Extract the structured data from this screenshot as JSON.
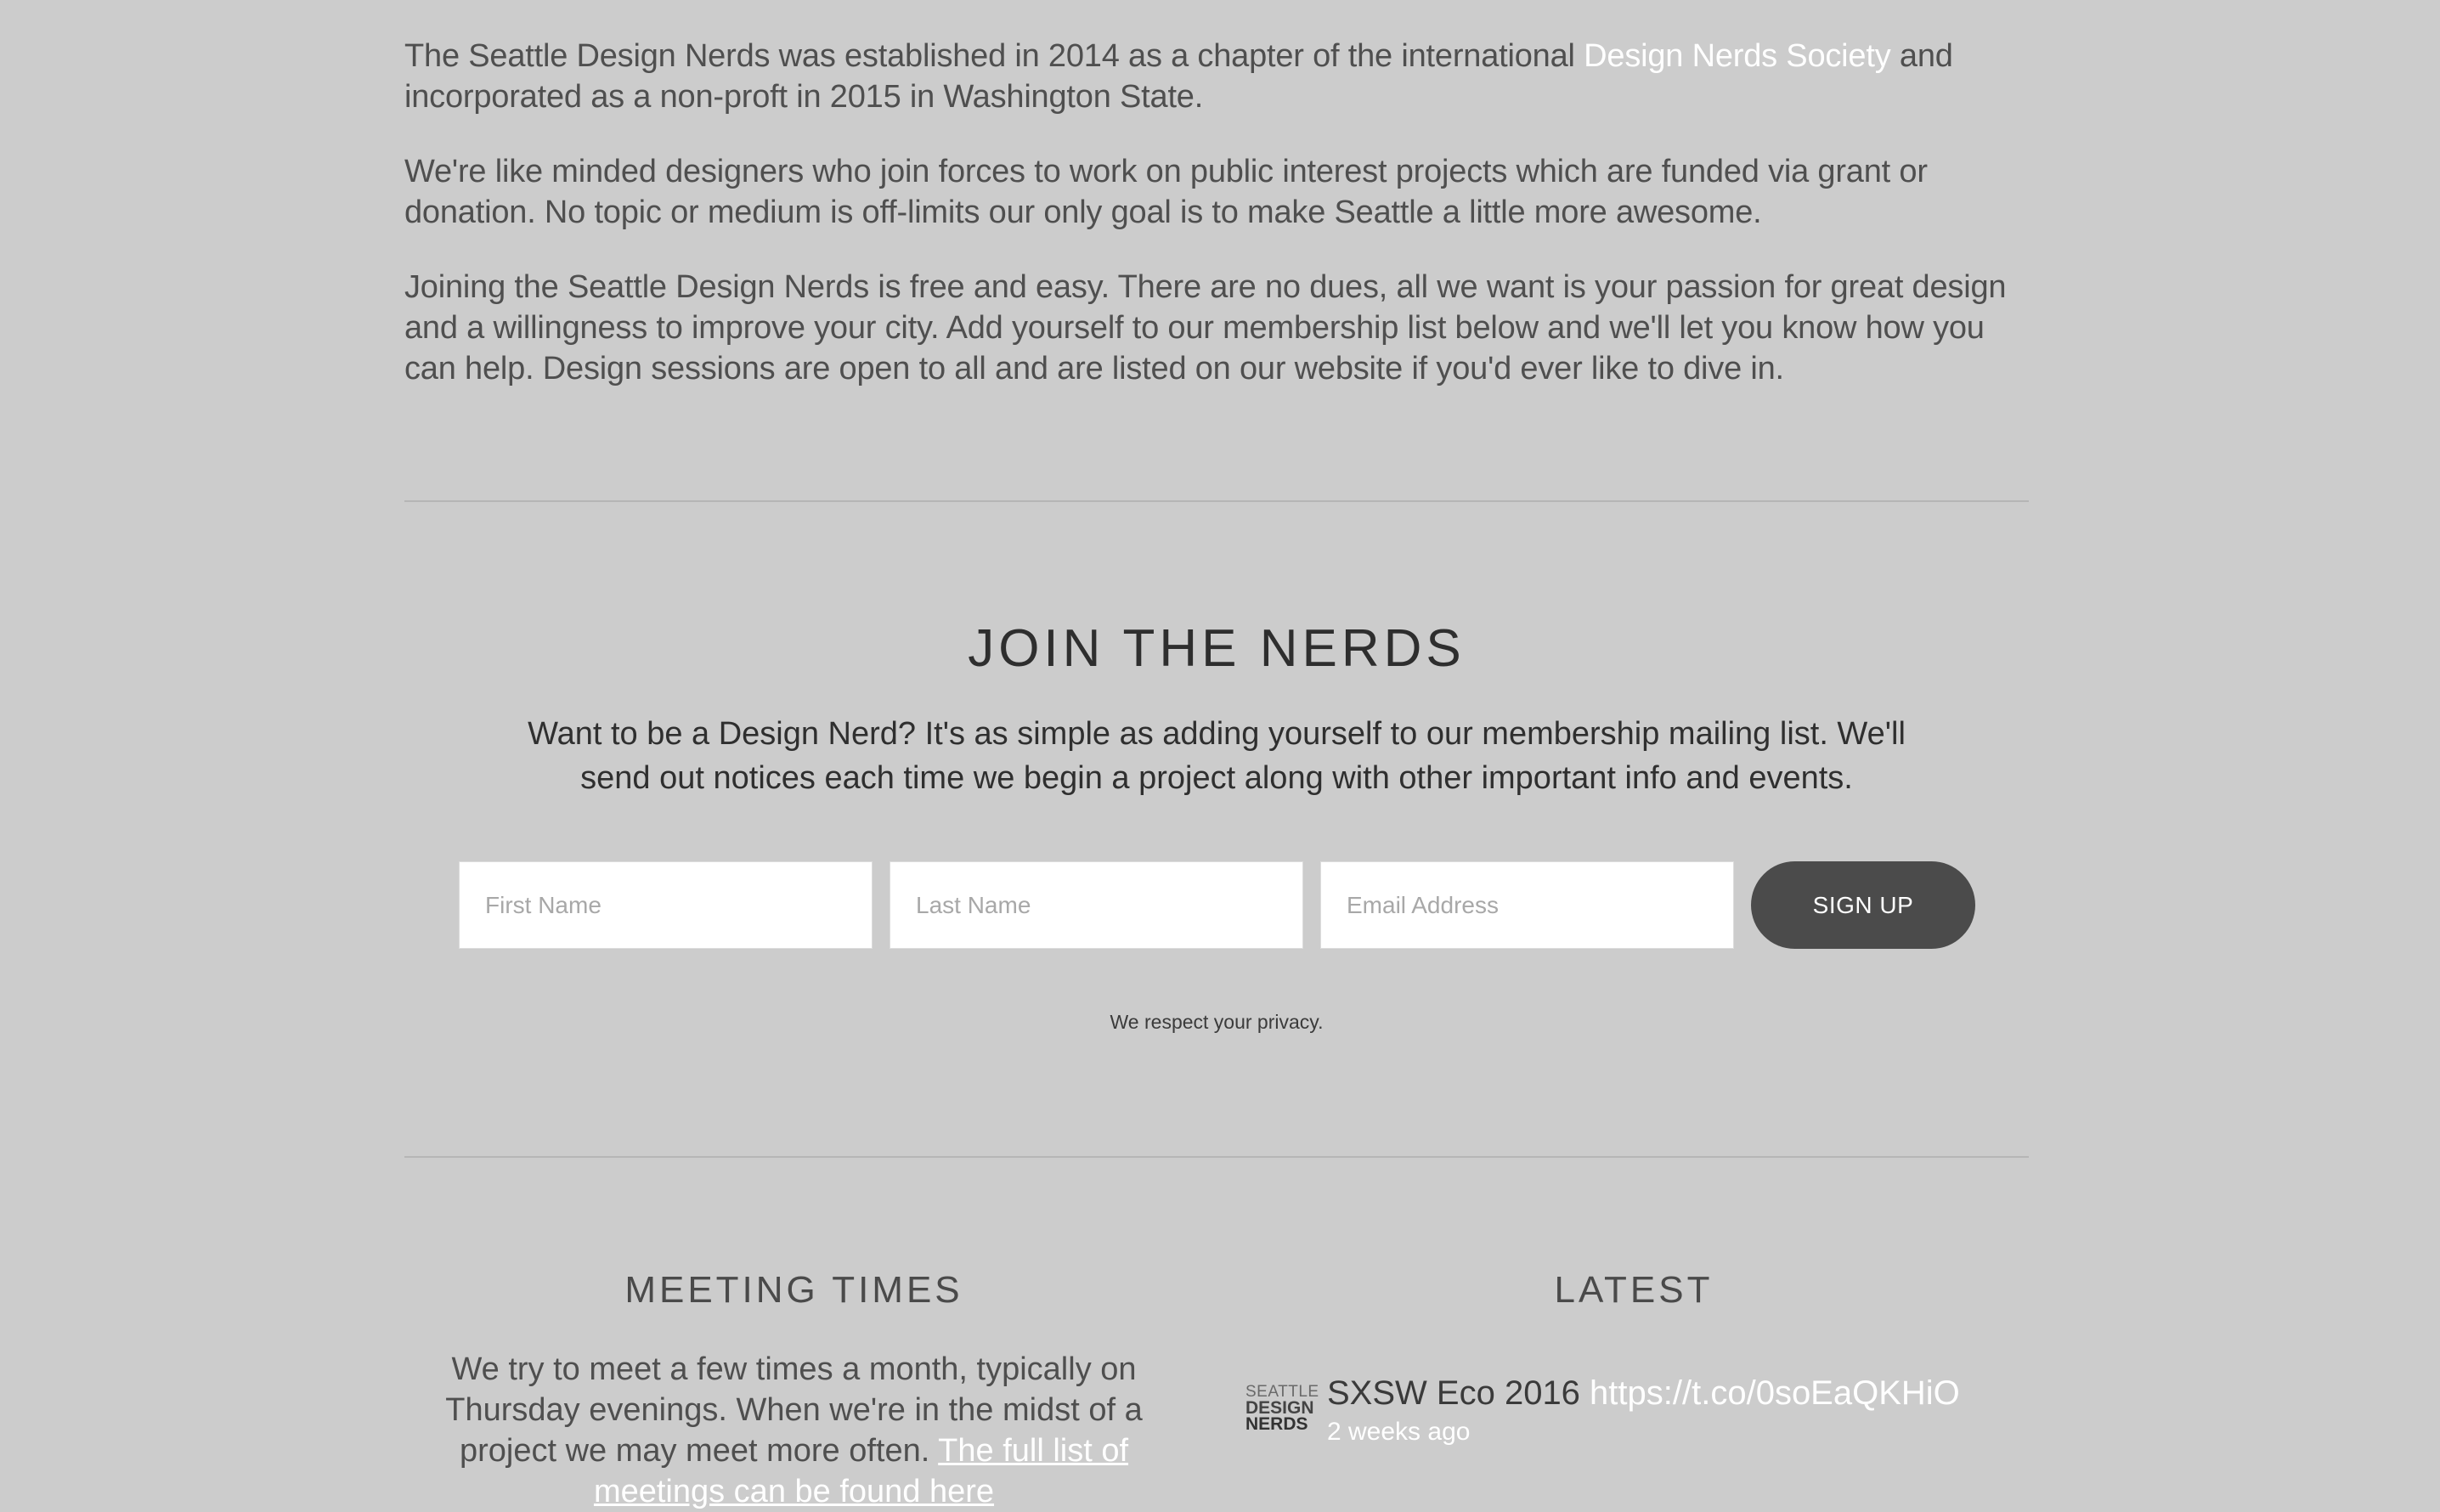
{
  "intro": {
    "p1_before": "The Seattle Design Nerds was established in 2014 as a chapter of the international ",
    "p1_link": "Design Nerds Society",
    "p1_after": " and incorporated as a non-proft in 2015 in Washington State.",
    "p2": "We're like minded designers who join forces to work on public interest projects which are funded via grant or donation.  No topic or medium is off-limits our only goal is to make Seattle a little more awesome.",
    "p3": "Joining the Seattle Design Nerds is free and easy. There are no dues, all we want is your passion for great design and a willingness to improve your city.  Add yourself to our membership list below and we'll let you know how you can help. Design sessions are open to all and are listed on our website if you'd ever like to dive in."
  },
  "join": {
    "title": "JOIN THE NERDS",
    "description": "Want to be a Design Nerd?  It's as simple as adding yourself to our membership mailing list. We'll send out notices each time we begin a project along with other important info and events.",
    "first_name_placeholder": "First Name",
    "last_name_placeholder": "Last Name",
    "email_placeholder": "Email Address",
    "signup_label": "SIGN UP",
    "privacy": "We respect your privacy."
  },
  "meeting": {
    "title": "MEETING TIMES",
    "text": "We try to meet a few times a month, typically on Thursday evenings.  When we're in the midst of a project we may meet more often.  ",
    "link": "The full list of meetings can be found here"
  },
  "latest": {
    "title": "LATEST",
    "logo_lines": [
      "SEATTLE",
      "DESIGN",
      "NERDS"
    ],
    "tweet_text": "SXSW Eco 2016 ",
    "tweet_link": "https://t.co/0soEaQKHiO",
    "tweet_time": "2 weeks ago"
  },
  "colors": {
    "background": "#cccccc",
    "link": "#ffffff",
    "button": "#4b4b4b",
    "text": "#4f4f4f"
  }
}
